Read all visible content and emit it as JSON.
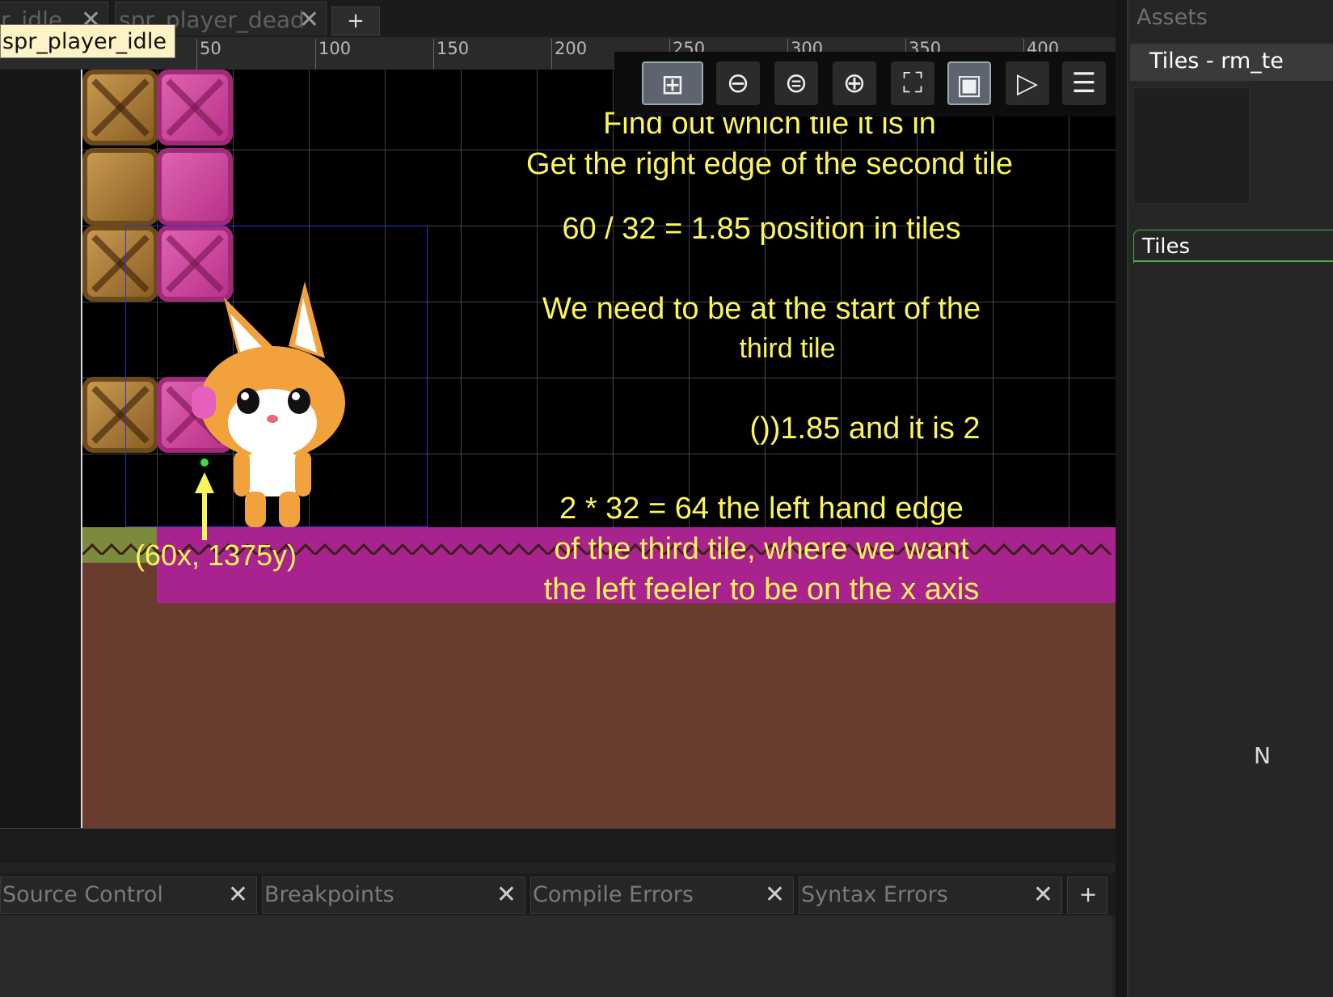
{
  "tabs": [
    {
      "label": "r_idle"
    },
    {
      "label": "spr_player_dead"
    }
  ],
  "tab_add_label": "+",
  "tab_close_glyph": "✕",
  "tooltip": "spr_player_idle",
  "ruler": {
    "ticks": [
      "50",
      "100",
      "150",
      "200",
      "250",
      "300",
      "350",
      "400"
    ]
  },
  "toolbar": {
    "buttons": [
      {
        "icon": "grid-icon",
        "glyph": "⊞"
      },
      {
        "icon": "zoom-out-icon",
        "glyph": "⊖"
      },
      {
        "icon": "zoom-reset-icon",
        "glyph": "⊜"
      },
      {
        "icon": "zoom-in-icon",
        "glyph": "⊕"
      },
      {
        "icon": "fullscreen-icon",
        "glyph": "⛶"
      },
      {
        "icon": "frame-icon",
        "glyph": "▣"
      },
      {
        "icon": "play-icon",
        "glyph": "▷"
      },
      {
        "icon": "layers-icon",
        "glyph": "☰"
      }
    ]
  },
  "annotation": {
    "line1": "Find out which tile it is in",
    "line2": "Get the right edge of the second tile",
    "line3": "60 / 32 = 1.85 position in tiles",
    "line4": "We need to be at the start of the",
    "line5": "third tile",
    "line6": "())1.85 and it is 2",
    "line7": "2 * 32 = 64 the left hand edge",
    "line8": "of the third tile, where we want",
    "line9": "the left feeler to be on the x axis",
    "point_label": "(60x, 1375y)"
  },
  "bottom_tabs": [
    {
      "label": "Source Control"
    },
    {
      "label": "Breakpoints"
    },
    {
      "label": "Compile Errors"
    },
    {
      "label": "Syntax Errors"
    }
  ],
  "bottom_add_label": "+",
  "right_panel": {
    "assets_title": "Assets",
    "tiles_header": "Tiles - rm_te",
    "tiles_tab": "Tiles",
    "n_label": "N"
  },
  "colors": {
    "annotation_text": "#fbf45c",
    "magenta_ground": "#a8238d",
    "dirt": "#6a3c30",
    "bbox": "#2b33d9",
    "feeler_dot": "#3bdc3b"
  }
}
